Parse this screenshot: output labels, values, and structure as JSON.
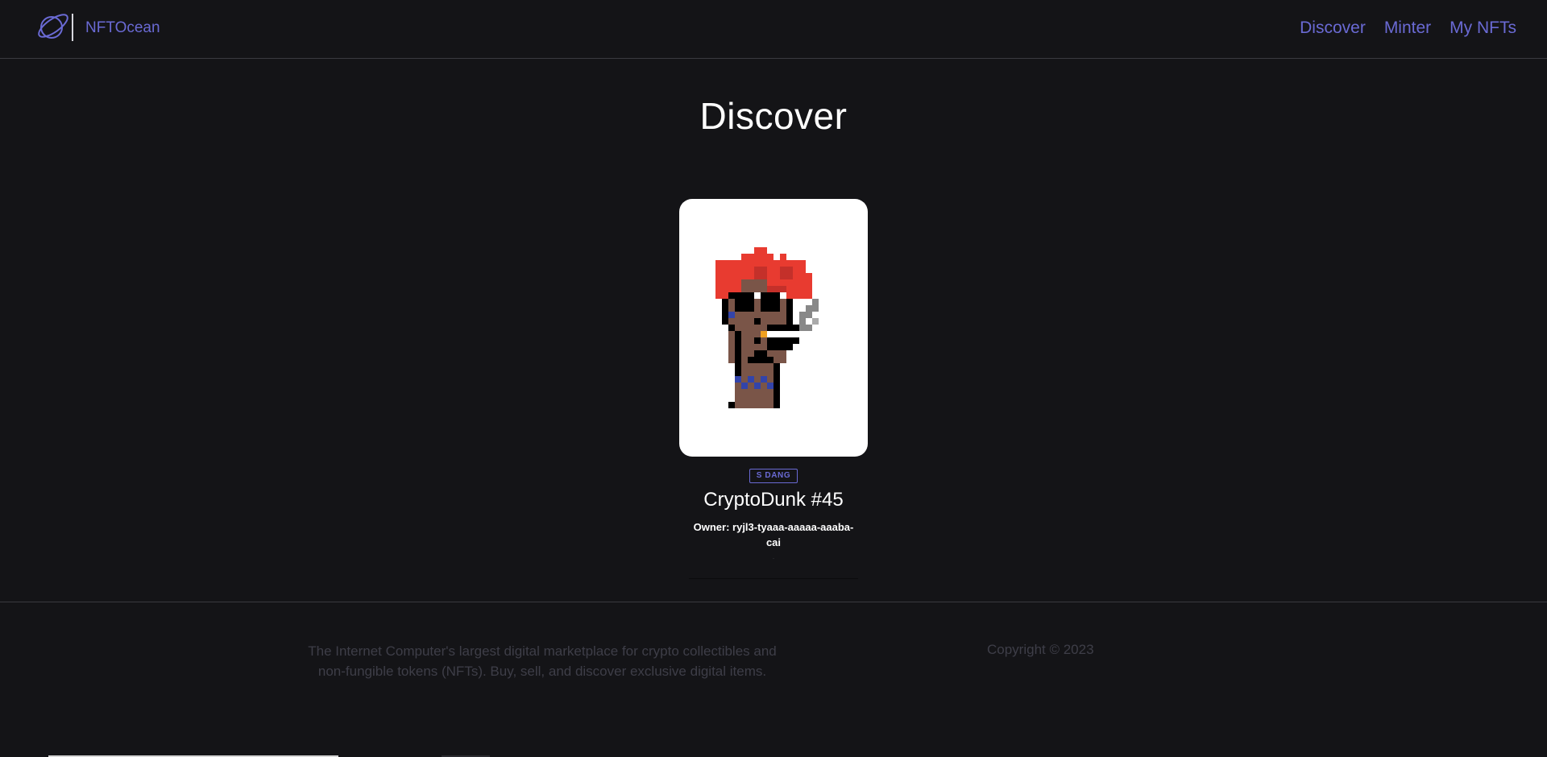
{
  "header": {
    "brand": "NFTOcean",
    "logo_icon": "planet-icon",
    "nav": [
      "Discover",
      "Minter",
      "My NFTs"
    ]
  },
  "main": {
    "title": "Discover",
    "card": {
      "badge": "S DANG",
      "name": "CryptoDunk #45",
      "owner": "Owner: ryjl3-tyaaa-aaaaa-aaaba-cai",
      "image_icon": "pixel-art-nft-icon"
    }
  },
  "footer": {
    "description": "The Internet Computer's largest digital marketplace for crypto collectibles and non-fungible tokens (NFTs). Buy, sell, and discover exclusive digital items.",
    "copyright": "Copyright © 2023"
  },
  "colors": {
    "background": "#141417",
    "accent": "#6a6ad4",
    "footer_text": "#3e3e48"
  }
}
